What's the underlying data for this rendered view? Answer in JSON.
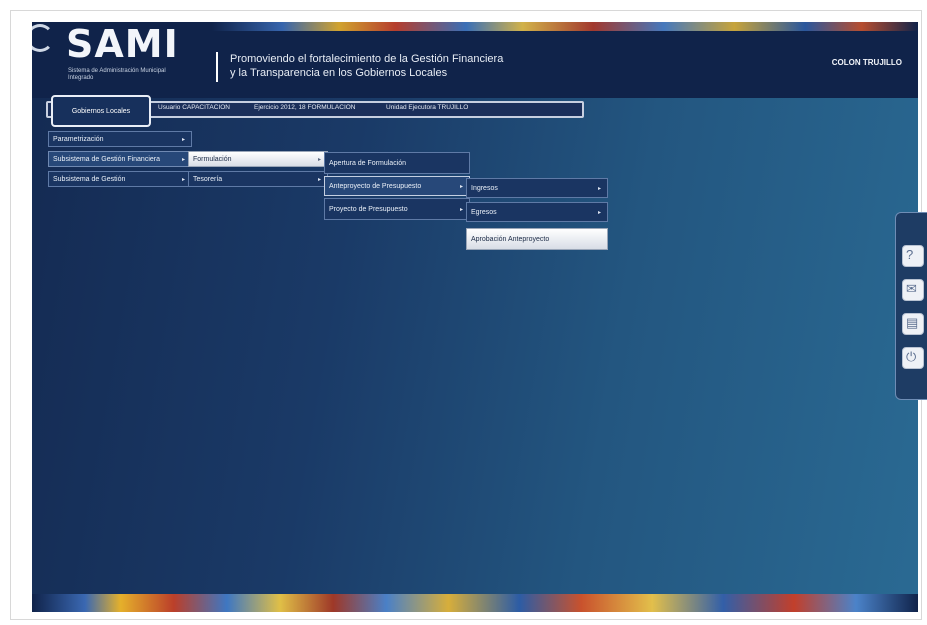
{
  "header": {
    "logo_text": "SAMI",
    "logo_subtitle": "Sistema de Administración Municipal Integrado",
    "tagline_line1": "Promoviendo el fortalecimiento de la Gestión Financiera",
    "tagline_line2": "y la Transparencia en los Gobiernos Locales",
    "user_name": "COLON TRUJILLO"
  },
  "info_bar": {
    "tab_label": "Gobiernos Locales",
    "user": "Usuario CAPACITACION",
    "period": "Ejercicio 2012, 18 FORMULACION",
    "unit": "Unidad Ejecutora TRUJILLO"
  },
  "menu": {
    "level1": [
      {
        "label": "Parametrización"
      },
      {
        "label": "Subsistema de Gestión Financiera"
      },
      {
        "label": "Subsistema de Gestión"
      }
    ],
    "level2": [
      {
        "label": "Formulación"
      },
      {
        "label": "Tesorería"
      }
    ],
    "level3": [
      {
        "label": "Apertura de Formulación"
      },
      {
        "label": "Anteproyecto de Presupuesto"
      },
      {
        "label": "Proyecto de Presupuesto"
      }
    ],
    "level4": [
      {
        "label": "Ingresos"
      },
      {
        "label": "Egresos"
      },
      {
        "label": "Aprobación Anteproyecto"
      }
    ]
  },
  "side_icons": [
    "help-icon",
    "mail-icon",
    "document-icon",
    "power-icon"
  ]
}
